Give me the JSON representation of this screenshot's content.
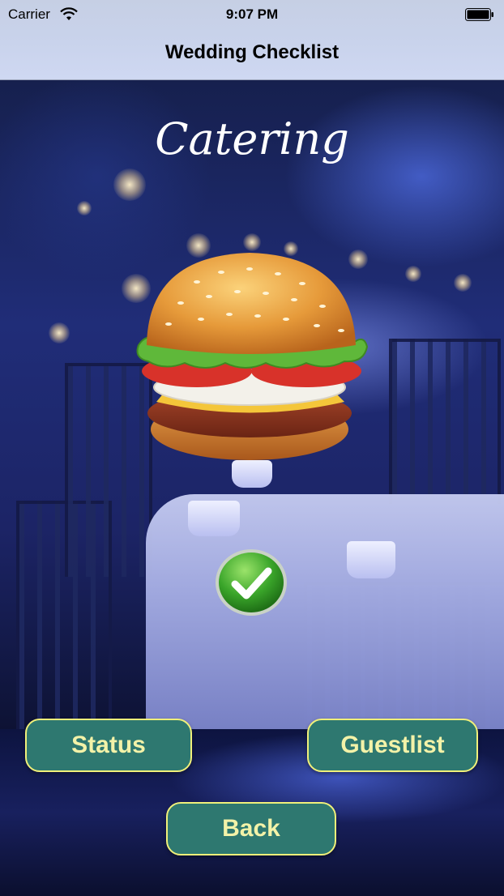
{
  "status_bar": {
    "carrier": "Carrier",
    "time": "9:07 PM"
  },
  "nav": {
    "title": "Wedding Checklist"
  },
  "screen": {
    "heading": "Catering",
    "image": "hamburger-illustration",
    "check_icon": "green-checkmark-icon"
  },
  "buttons": {
    "status": "Status",
    "guestlist": "Guestlist",
    "back": "Back"
  },
  "colors": {
    "button_fill": "#2e7870",
    "button_border": "#f0f07a",
    "button_text": "#f3f2a8",
    "nav_bar": "#c9d3ec"
  }
}
